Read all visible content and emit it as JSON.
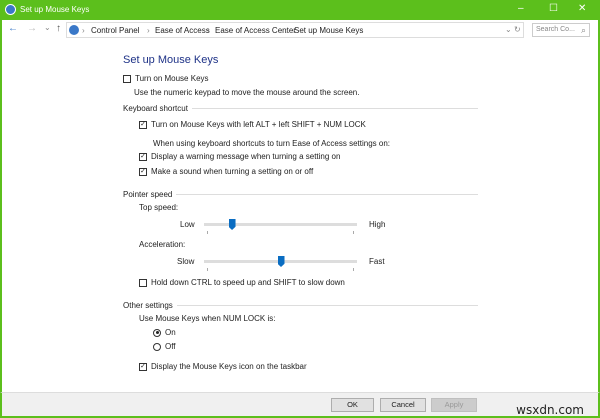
{
  "window": {
    "title": "Set up Mouse Keys",
    "minimize": "–",
    "maximize": "☐",
    "close": "✕"
  },
  "nav": {
    "back": "←",
    "forward": "→",
    "recent": "⌄",
    "up": "↑",
    "dropdown": "⌄",
    "refresh": "↻",
    "search_placeholder": "Search Co...",
    "search_icon": "⌕",
    "breadcrumbs": [
      "Control Panel",
      "Ease of Access",
      "Ease of Access Center",
      "Set up Mouse Keys"
    ],
    "sep": "›"
  },
  "page": {
    "heading": "Set up Mouse Keys",
    "turn_on": {
      "label": "Turn on Mouse Keys",
      "checked": false
    },
    "turn_on_desc": "Use the numeric keypad to move the mouse around the screen.",
    "keyboard_shortcut": {
      "title": "Keyboard shortcut",
      "shortcut": {
        "label": "Turn on Mouse Keys with left ALT + left SHIFT + NUM LOCK",
        "checked": true
      },
      "when_text": "When using keyboard shortcuts to turn Ease of Access settings on:",
      "warning": {
        "label": "Display a warning message when turning a setting on",
        "checked": true
      },
      "sound": {
        "label": "Make a sound when turning a setting on or off",
        "checked": true
      }
    },
    "pointer_speed": {
      "title": "Pointer speed",
      "top_speed_label": "Top speed:",
      "low": "Low",
      "high": "High",
      "top_speed_value": 0.18,
      "accel_label": "Acceleration:",
      "slow": "Slow",
      "fast": "Fast",
      "accel_value": 0.5,
      "ctrl_shift": {
        "label": "Hold down CTRL to speed up and SHIFT to slow down",
        "checked": false
      }
    },
    "other": {
      "title": "Other settings",
      "numlock_label": "Use Mouse Keys when NUM LOCK is:",
      "on": "On",
      "off": "Off",
      "selected": "On",
      "taskbar": {
        "label": "Display the Mouse Keys icon on the taskbar",
        "checked": true
      }
    }
  },
  "footer": {
    "ok": "OK",
    "cancel": "Cancel",
    "apply": "Apply"
  },
  "watermark": "wsxdn.com"
}
